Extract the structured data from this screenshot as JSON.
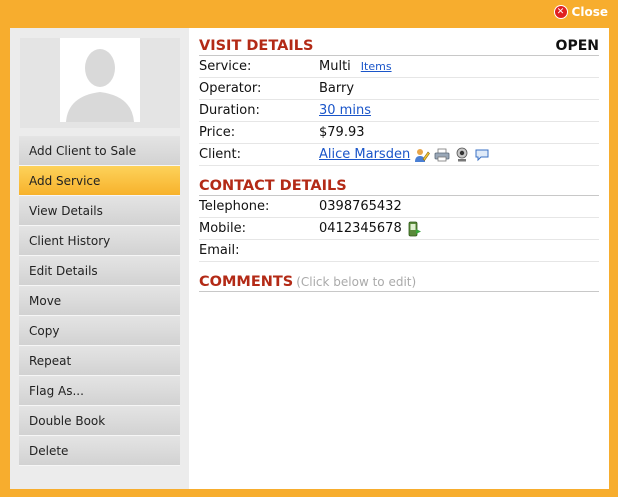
{
  "close": {
    "label": "Close"
  },
  "sidebar": {
    "items": [
      {
        "label": "Add Client to Sale"
      },
      {
        "label": "Add Service"
      },
      {
        "label": "View Details"
      },
      {
        "label": "Client History"
      },
      {
        "label": "Edit Details"
      },
      {
        "label": "Move"
      },
      {
        "label": "Copy"
      },
      {
        "label": "Repeat"
      },
      {
        "label": "Flag As..."
      },
      {
        "label": "Double Book"
      },
      {
        "label": "Delete"
      }
    ],
    "active_index": 1
  },
  "visit": {
    "title": "VISIT DETAILS",
    "status": "OPEN",
    "service_label": "Service:",
    "service_value": "Multi",
    "items_link": "Items",
    "operator_label": "Operator:",
    "operator_value": "Barry",
    "duration_label": "Duration:",
    "duration_value": "30 mins",
    "price_label": "Price:",
    "price_value": "$79.93",
    "client_label": "Client:",
    "client_value": "Alice Marsden",
    "client_icons": [
      "edit-client-icon",
      "print-icon",
      "webcam-icon",
      "sms-icon"
    ]
  },
  "contact": {
    "title": "CONTACT DETAILS",
    "telephone_label": "Telephone:",
    "telephone_value": "0398765432",
    "mobile_label": "Mobile:",
    "mobile_value": "0412345678",
    "mobile_icon": "send-sms-icon",
    "email_label": "Email:",
    "email_value": ""
  },
  "comments": {
    "title": "COMMENTS",
    "hint": "(Click below to edit)"
  },
  "colors": {
    "background": "#f7ad2e",
    "section_title": "#b32a16",
    "link": "#1a55c9",
    "active_menu": "#f7b22c"
  }
}
